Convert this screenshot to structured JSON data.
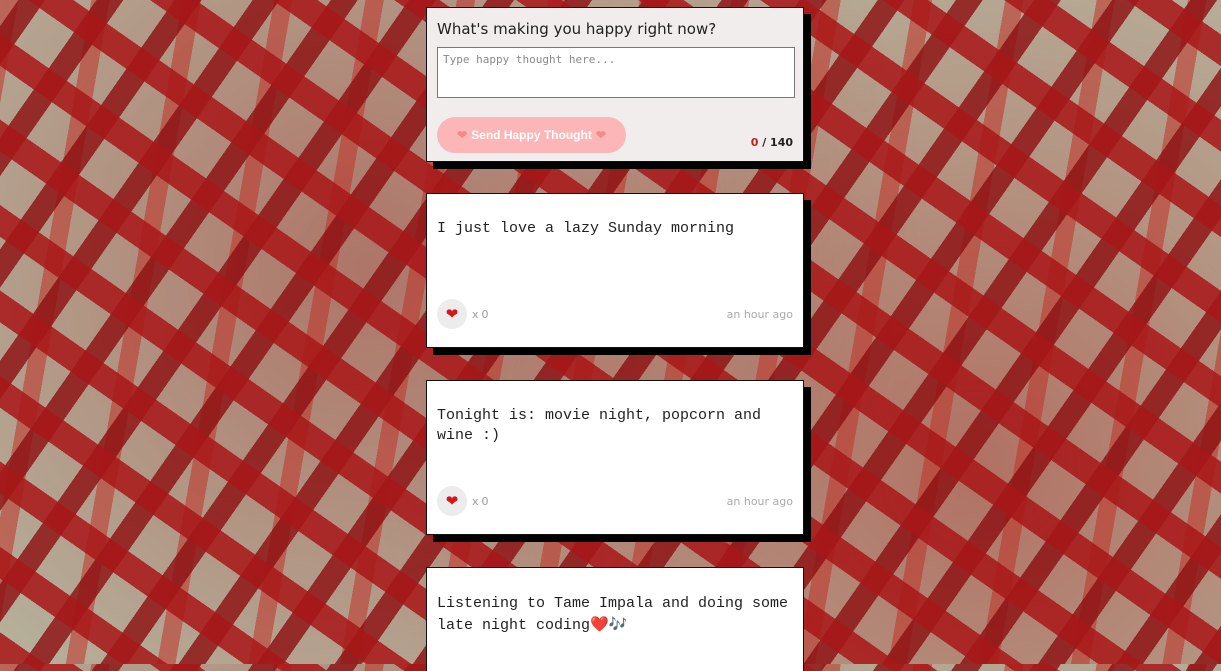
{
  "composer": {
    "question": "What's making you happy right now?",
    "placeholder": "Type happy thought here...",
    "value": "",
    "send_label": "Send Happy Thought",
    "char_current": "0",
    "char_max": "/ 140",
    "accent_color": "#fdb6b7"
  },
  "thoughts": [
    {
      "text": "I just love a lazy Sunday morning",
      "like_prefix": "x",
      "likes": "0",
      "time": "an hour ago"
    },
    {
      "text": "Tonight is: movie night, popcorn and wine :)",
      "like_prefix": "x",
      "likes": "0",
      "time": "an hour ago"
    },
    {
      "text": "Listening to Tame Impala and doing some late night coding",
      "emojis": "❤️🎶"
    }
  ],
  "icons": {
    "heart": "heart-icon",
    "music": "music-notes-icon"
  }
}
